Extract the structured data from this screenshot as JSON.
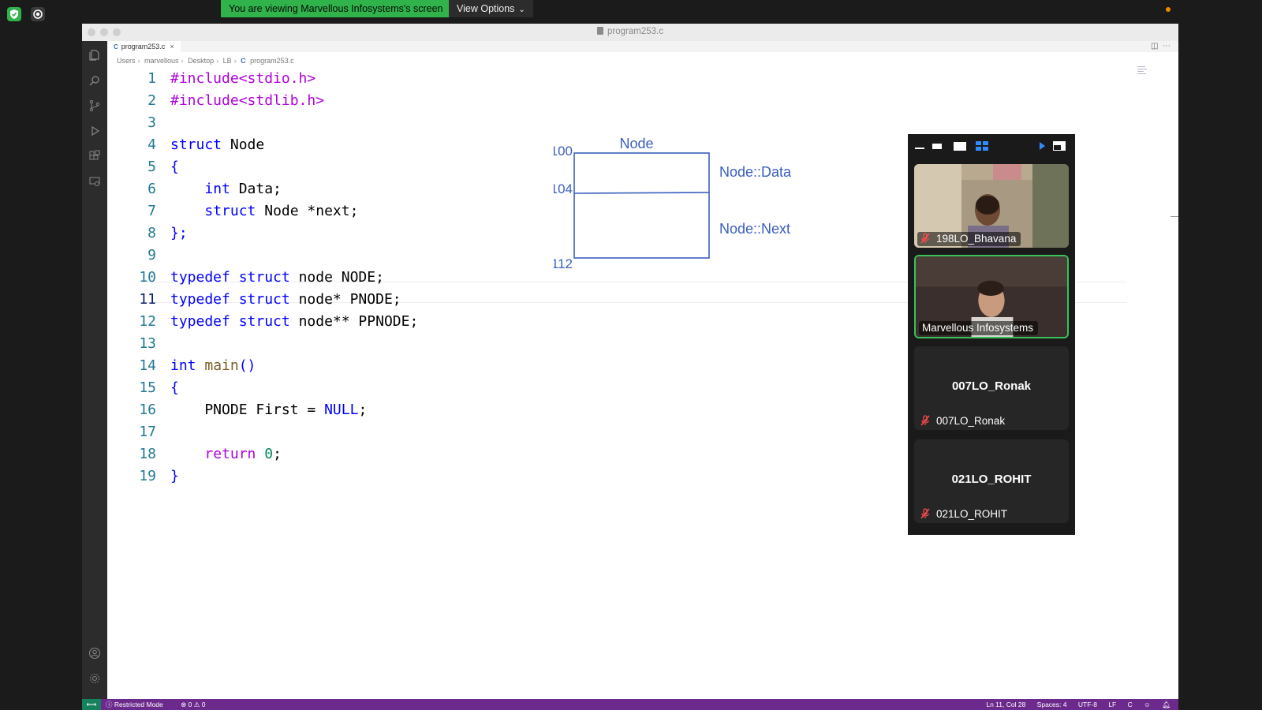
{
  "zoom": {
    "share_banner": "You are viewing Marvellous Infosystems's screen",
    "view_options": "View Options",
    "participants": [
      {
        "name": "198LO_Bhavana",
        "muted": true,
        "video": true,
        "speaking": false
      },
      {
        "name": "Marvellous Infosystems",
        "muted": false,
        "video": true,
        "speaking": true
      },
      {
        "name": "007LO_Ronak",
        "muted": true,
        "video": false,
        "speaking": false
      },
      {
        "name": "021LO_ROHIT",
        "muted": true,
        "video": false,
        "speaking": false
      }
    ]
  },
  "vscode": {
    "window_title": "program253.c",
    "tab": {
      "label": "program253.c",
      "close": "×",
      "icon": "C"
    },
    "breadcrumb": [
      "Users",
      "marvellous",
      "Desktop",
      "LB",
      "program253.c"
    ],
    "breadcrumb_icon": "C",
    "code_lines": [
      "#include<stdio.h>",
      "#include<stdlib.h>",
      "",
      "struct Node",
      "{",
      "    int Data;",
      "    struct Node *next;",
      "};",
      "",
      "typedef struct node NODE;",
      "typedef struct node* PNODE;",
      "typedef struct node** PPNODE;",
      "",
      "int main()",
      "{",
      "    PNODE First = NULL;",
      "",
      "    return 0;",
      "}"
    ],
    "line_numbers": [
      "1",
      "2",
      "3",
      "4",
      "5",
      "6",
      "7",
      "8",
      "9",
      "10",
      "11",
      "12",
      "13",
      "14",
      "15",
      "16",
      "17",
      "18",
      "19"
    ],
    "active_line": 11,
    "status": {
      "restricted": "Restricted Mode",
      "problems": "⊗ 0 ⚠ 0",
      "position": "Ln 11, Col 28",
      "spaces": "Spaces: 4",
      "encoding": "UTF-8",
      "eol": "LF",
      "language": "C"
    }
  },
  "diagram": {
    "title": "Node",
    "addresses": [
      "100",
      "104",
      "112"
    ],
    "labels": [
      "Node::Data",
      "Node::Next"
    ],
    "color": "#3b5fc0"
  },
  "colors": {
    "share_green": "#2fb34a",
    "status_purple": "#6c2a8c",
    "speaking_border": "#39c25a"
  }
}
